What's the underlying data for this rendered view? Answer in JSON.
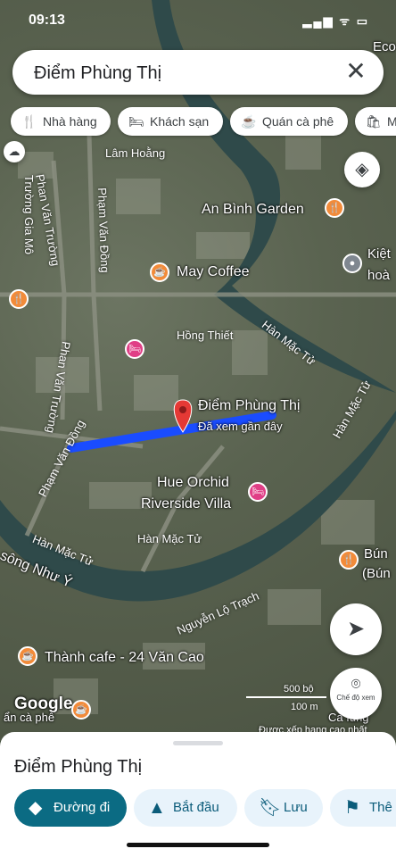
{
  "status_bar": {
    "time": "09:13",
    "icons": "▂▄▆ ᯤ ▭"
  },
  "search": {
    "query": "Điểm Phùng Thị",
    "clear_icon": "close-icon"
  },
  "chips": [
    {
      "icon": "🍴",
      "label": "Nhà hàng"
    },
    {
      "icon": "🛏",
      "label": "Khách sạn"
    },
    {
      "icon": "☕",
      "label": "Quán cà phê"
    },
    {
      "icon": "🛍",
      "label": "M"
    }
  ],
  "map": {
    "selected_place": {
      "name": "Điểm Phùng Thị",
      "subtitle": "Đã xem gần đây"
    },
    "places": {
      "an_binh": "An Bình Garden",
      "may_coffee": "May Coffee",
      "hue_orchid_1": "Hue Orchid",
      "hue_orchid_2": "Riverside Villa",
      "thanh_cafe": "Thành cafe - 24 Văn Cao",
      "kiet": "Kiệt",
      "hoa": "hoà",
      "bun": "Bún",
      "bun2": "(Bún",
      "eco": "Eco",
      "cafe_left": "ẩn cà phê",
      "cafe_right": "Cà fung"
    },
    "streets": {
      "lam_hoang": "Lâm Hoằng",
      "phan_van_truong_1": "Phan Văn Trường",
      "truong_gia_mo": "Trường Gia Mô",
      "pham_van_dong_1": "Phạm Văn Đồng",
      "hong_thiet": "Hồng Thiết",
      "han_mac_tu_1": "Hàn Mặc Tử",
      "han_mac_tu_2": "Hàn Mặc Tử",
      "han_mac_tu_3": "Hàn Mặc Tử",
      "han_mac_tu_4": "Hàn Mặc Tử",
      "han_mac_tu_5": "Hàn Mặc Tử",
      "phan_van_truong_2": "Phan Văn Trường",
      "pham_van_dong_2": "Phạm Văn Đồng",
      "song_nhu_y": "sông Như Ý",
      "nguyen_lo_trach": "Nguyễn Lộ Trạch"
    },
    "scale": {
      "label1": "500 bộ",
      "label2": "100 m"
    },
    "google": "Google",
    "street_view_label": "Chế độ xem",
    "bottom_hint": "Được xếp hạng cao nhất"
  },
  "sheet": {
    "title": "Điểm Phùng Thị",
    "actions": [
      {
        "icon": "directions-icon",
        "label": "Đường đi"
      },
      {
        "icon": "navigate-icon",
        "label": "Bắt đầu"
      },
      {
        "icon": "bookmark-icon",
        "label": "Lưu"
      },
      {
        "icon": "flag-icon",
        "label": "Thê"
      }
    ]
  },
  "colors": {
    "route": "#1a4cff",
    "pin": "#e53935",
    "primary": "#0b6b83"
  }
}
